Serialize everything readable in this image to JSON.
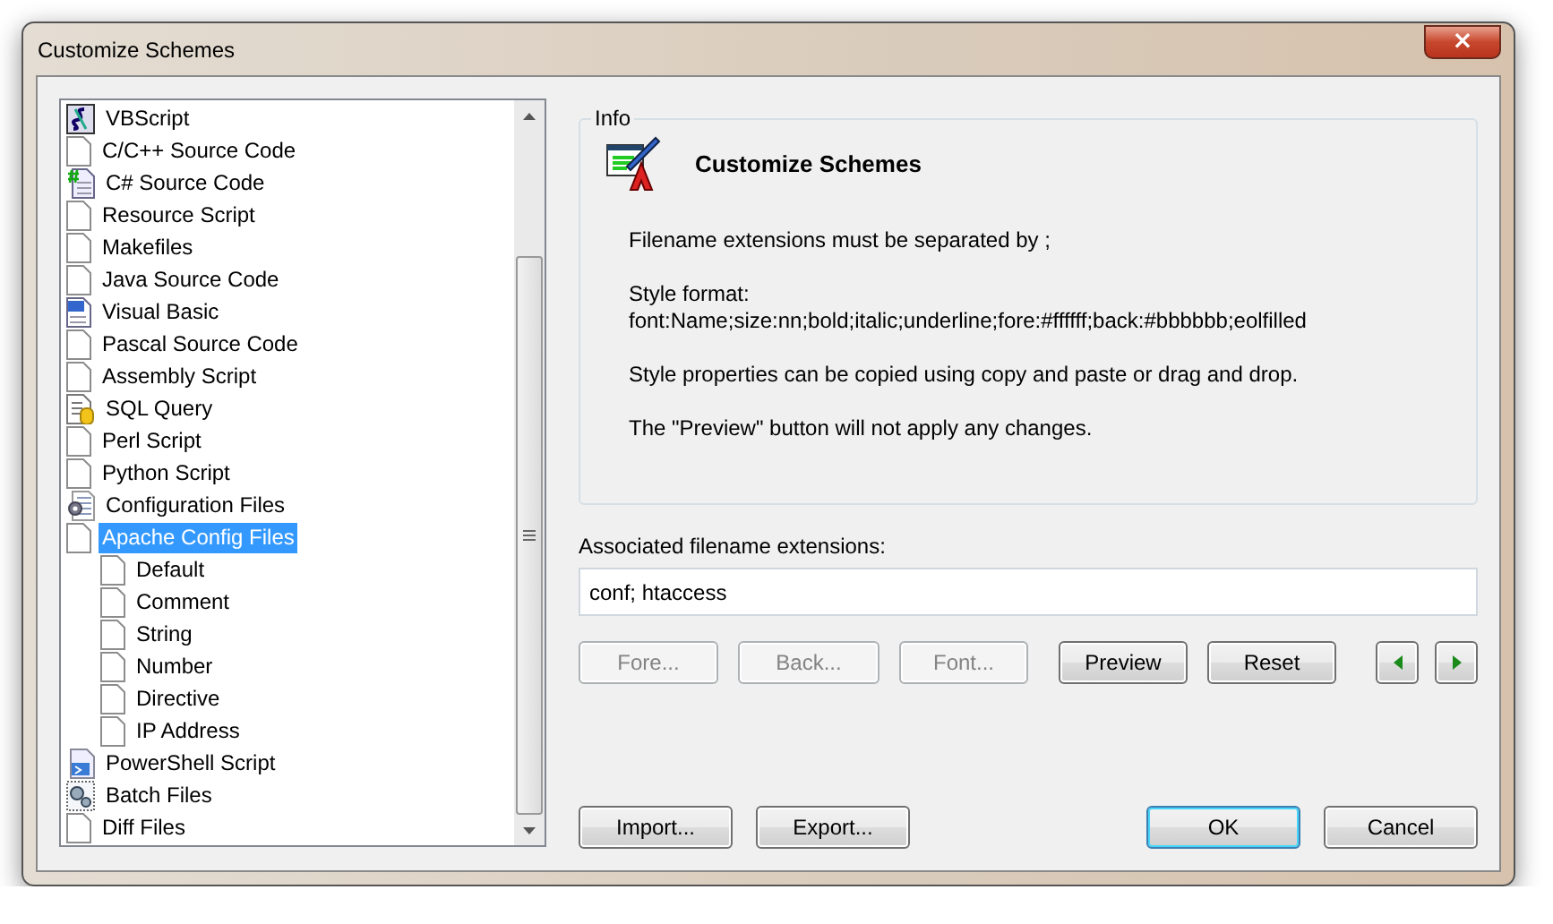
{
  "window": {
    "title": "Customize Schemes",
    "close": "×"
  },
  "tree": [
    {
      "label": "VBScript",
      "kind": "script",
      "selected": false
    },
    {
      "label": "C/C++ Source Code",
      "kind": "doc",
      "selected": false
    },
    {
      "label": "C# Source Code",
      "kind": "csharp",
      "selected": false
    },
    {
      "label": "Resource Script",
      "kind": "doc",
      "selected": false
    },
    {
      "label": "Makefiles",
      "kind": "doc",
      "selected": false
    },
    {
      "label": "Java Source Code",
      "kind": "doc",
      "selected": false
    },
    {
      "label": "Visual Basic",
      "kind": "vb",
      "selected": false
    },
    {
      "label": "Pascal Source Code",
      "kind": "doc",
      "selected": false
    },
    {
      "label": "Assembly Script",
      "kind": "doc",
      "selected": false
    },
    {
      "label": "SQL Query",
      "kind": "sql",
      "selected": false
    },
    {
      "label": "Perl Script",
      "kind": "doc",
      "selected": false
    },
    {
      "label": "Python Script",
      "kind": "doc",
      "selected": false
    },
    {
      "label": "Configuration Files",
      "kind": "config",
      "selected": false
    },
    {
      "label": "Apache Config Files",
      "kind": "doc",
      "selected": true,
      "children": [
        {
          "label": "Default",
          "kind": "doc",
          "selected": false
        },
        {
          "label": "Comment",
          "kind": "doc",
          "selected": false
        },
        {
          "label": "String",
          "kind": "doc",
          "selected": false
        },
        {
          "label": "Number",
          "kind": "doc",
          "selected": false
        },
        {
          "label": "Directive",
          "kind": "doc",
          "selected": false
        },
        {
          "label": "IP Address",
          "kind": "doc",
          "selected": false
        }
      ]
    },
    {
      "label": "PowerShell Script",
      "kind": "powershell",
      "selected": false
    },
    {
      "label": "Batch Files",
      "kind": "batch",
      "selected": false
    },
    {
      "label": "Diff Files",
      "kind": "doc",
      "selected": false
    }
  ],
  "info": {
    "group_label": "Info",
    "heading": "Customize Schemes",
    "paragraphs": [
      "Filename extensions must be separated by ;",
      "Style format:\nfont:Name;size:nn;bold;italic;underline;fore:#ffffff;back:#bbbbbb;eolfilled",
      "Style properties can be copied using copy and paste or drag and drop.",
      "The \"Preview\" button will not apply any changes."
    ]
  },
  "extensions": {
    "label": "Associated filename extensions:",
    "value": "conf; htaccess"
  },
  "style_buttons": [
    {
      "label": "Fore...",
      "disabled": true
    },
    {
      "label": "Back...",
      "disabled": true
    },
    {
      "label": "Font...",
      "disabled": true
    },
    {
      "label": "Preview",
      "disabled": false
    },
    {
      "label": "Reset",
      "disabled": false
    }
  ],
  "nav_buttons": [
    {
      "kind": "previous"
    },
    {
      "kind": "next"
    }
  ],
  "bottom_buttons": [
    {
      "label": "Import...",
      "default": false
    },
    {
      "label": "Export...",
      "default": false
    },
    {
      "label": "OK",
      "default": true
    },
    {
      "label": "Cancel",
      "default": false
    }
  ]
}
